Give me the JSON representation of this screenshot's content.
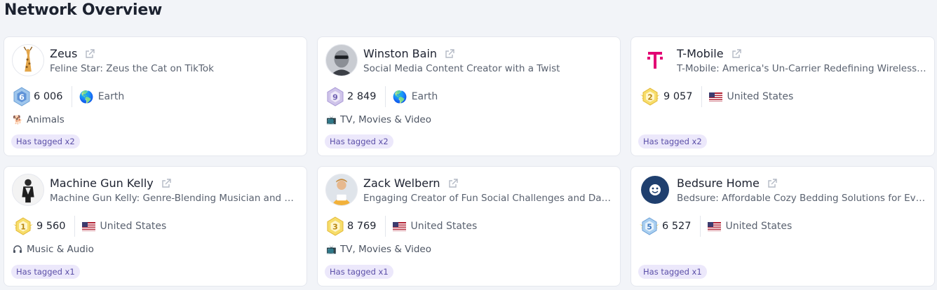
{
  "page": {
    "title": "Network Overview"
  },
  "cards": [
    {
      "name": "Zeus",
      "description": "Feline Star: Zeus the Cat on TikTok",
      "avatar_icon": "giraffe-avatar",
      "rank": "6",
      "rank_style": "blue-hex",
      "followers": "6 006",
      "location_icon": "earth-globe",
      "location": "Earth",
      "category_icon": "animals-icon",
      "category": "Animals",
      "tag": "Has tagged x2"
    },
    {
      "name": "Winston Bain",
      "description": "Social Media Content Creator with a Twist",
      "avatar_icon": "person-sunglasses-avatar",
      "rank": "9",
      "rank_style": "purple-hex",
      "followers": "2 849",
      "location_icon": "earth-globe",
      "location": "Earth",
      "category_icon": "tv-icon",
      "category": "TV, Movies & Video",
      "tag": "Has tagged x2"
    },
    {
      "name": "T-Mobile",
      "description": "T-Mobile: America's Un-Carrier Redefining Wireless Service",
      "avatar_icon": "tmobile-logo",
      "rank": "2",
      "rank_style": "gold-winged",
      "followers": "9 057",
      "location_icon": "us-flag",
      "location": "United States",
      "category_icon": "",
      "category": "",
      "tag": "Has tagged x2"
    },
    {
      "name": "Machine Gun Kelly",
      "description": "Machine Gun Kelly: Genre-Blending Musician and Style Icon",
      "avatar_icon": "person-avatar",
      "rank": "1",
      "rank_style": "gold-winged",
      "followers": "9 560",
      "location_icon": "us-flag",
      "location": "United States",
      "category_icon": "headphones-icon",
      "category": "Music & Audio",
      "tag": "Has tagged x1"
    },
    {
      "name": "Zack Welbern",
      "description": "Engaging Creator of Fun Social Challenges and Dating Content",
      "avatar_icon": "person-avatar",
      "rank": "3",
      "rank_style": "gold-hex",
      "followers": "8 769",
      "location_icon": "us-flag",
      "location": "United States",
      "category_icon": "tv-icon",
      "category": "TV, Movies & Video",
      "tag": "Has tagged x1"
    },
    {
      "name": "Bedsure Home",
      "description": "Bedsure: Affordable Cozy Bedding Solutions for Everyone",
      "avatar_icon": "bedsure-logo",
      "rank": "5",
      "rank_style": "blue-winged",
      "followers": "6 527",
      "location_icon": "us-flag",
      "location": "United States",
      "category_icon": "",
      "category": "",
      "tag": "Has tagged x1"
    }
  ],
  "colors": {
    "background": "#f2f4f8",
    "card": "#ffffff",
    "tag_bg": "#ece8fb",
    "tag_text": "#5b4fa8",
    "tmobile": "#e20074",
    "bedsure": "#1f3f6e"
  }
}
